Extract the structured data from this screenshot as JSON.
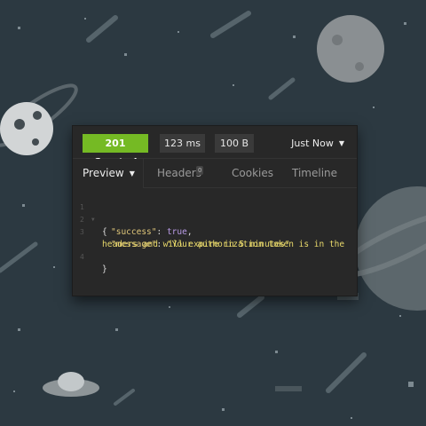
{
  "response": {
    "status": "201 Created",
    "time": "123 ms",
    "size": "100 B",
    "time_menu": "Just Now"
  },
  "tabs": {
    "preview": "Preview",
    "headers": "Headers",
    "headers_count": "0",
    "cookies": "Cookies",
    "timeline": "Timeline"
  },
  "code": {
    "line_numbers": [
      "1",
      "2",
      "3",
      "",
      "4"
    ],
    "open_brace": "{",
    "success_key": "\"success\"",
    "success_value": "true",
    "message_key": "\"message\"",
    "message_value_1": "\"Your authorization token is in the",
    "message_value_2": "headers and will expire in 5 minutes\"",
    "close_brace": "}"
  },
  "colors": {
    "status_ok": "#75ba24",
    "panel_bg": "#282828",
    "background": "#2c3941"
  }
}
